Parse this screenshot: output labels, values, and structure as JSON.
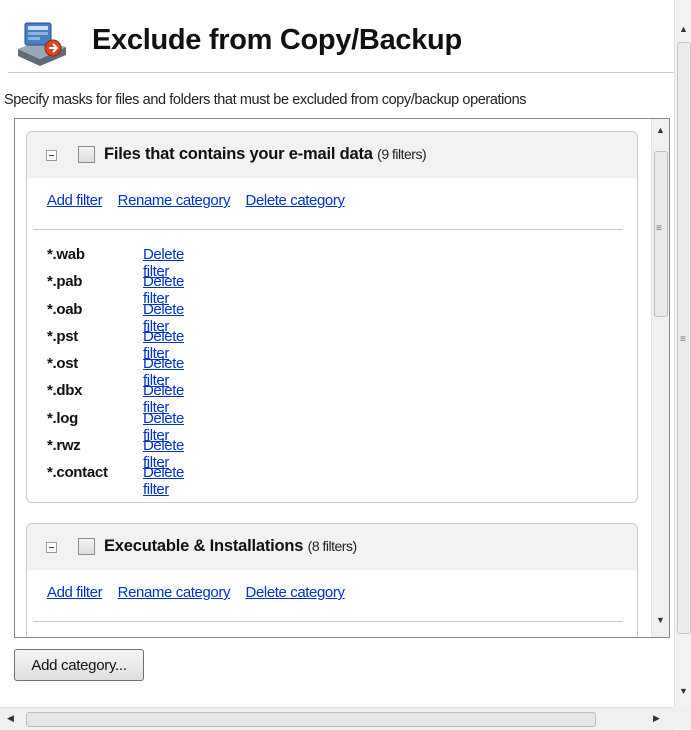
{
  "header": {
    "title": "Exclude from Copy/Backup",
    "app_icon": "drive-backup-icon"
  },
  "description": "Specify masks for files and folders that must be excluded from copy/backup operations",
  "categories": [
    {
      "name": "Files that contains your e-mail data",
      "count": "(9 filters)",
      "checked": false,
      "actions": {
        "add": "Add filter",
        "rename": "Rename category",
        "delete": "Delete category"
      },
      "filters": [
        {
          "mask": "*.wab",
          "action": "Delete filter"
        },
        {
          "mask": "*.pab",
          "action": "Delete filter"
        },
        {
          "mask": "*.oab",
          "action": "Delete filter"
        },
        {
          "mask": "*.pst",
          "action": "Delete filter"
        },
        {
          "mask": "*.ost",
          "action": "Delete filter"
        },
        {
          "mask": "*.dbx",
          "action": "Delete filter"
        },
        {
          "mask": "*.log",
          "action": "Delete filter"
        },
        {
          "mask": "*.rwz",
          "action": "Delete filter"
        },
        {
          "mask": "*.contact",
          "action": "Delete filter"
        }
      ]
    },
    {
      "name": "Executable & Installations",
      "count": "(8 filters)",
      "checked": false,
      "actions": {
        "add": "Add filter",
        "rename": "Rename category",
        "delete": "Delete category"
      }
    }
  ],
  "add_category_button": "Add category...",
  "colors": {
    "link": "#0033cc",
    "category_header": "#f2f2f2",
    "border": "#c9c9c9"
  }
}
